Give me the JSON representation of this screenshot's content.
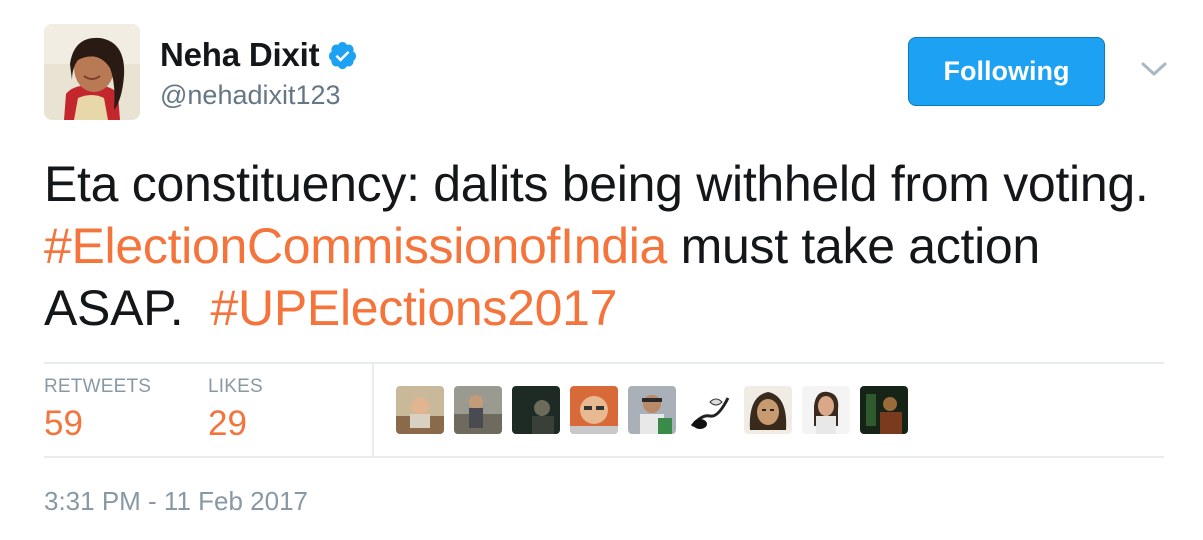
{
  "author": {
    "display_name": "Neha Dixit",
    "handle": "@nehadixit123",
    "verified_icon": "verified-badge-icon"
  },
  "follow_button": {
    "label": "Following"
  },
  "caret_icon": "chevron-down-icon",
  "tweet": {
    "text_1": "Eta constituency: dalits being withheld from voting. ",
    "hashtag_1": "#ElectionCommissionofIndia",
    "text_2": " must take action ASAP.  ",
    "hashtag_2": "#UPElections2017"
  },
  "stats": {
    "retweets_label": "RETWEETS",
    "retweets_value": "59",
    "likes_label": "LIKES",
    "likes_value": "29"
  },
  "likers_count_shown": 9,
  "timestamp": "3:31 PM - 11 Feb 2017",
  "colors": {
    "link": "#f4743b",
    "button": "#1da1f2",
    "muted": "#8899a6",
    "handle": "#657786",
    "text": "#14171a"
  }
}
